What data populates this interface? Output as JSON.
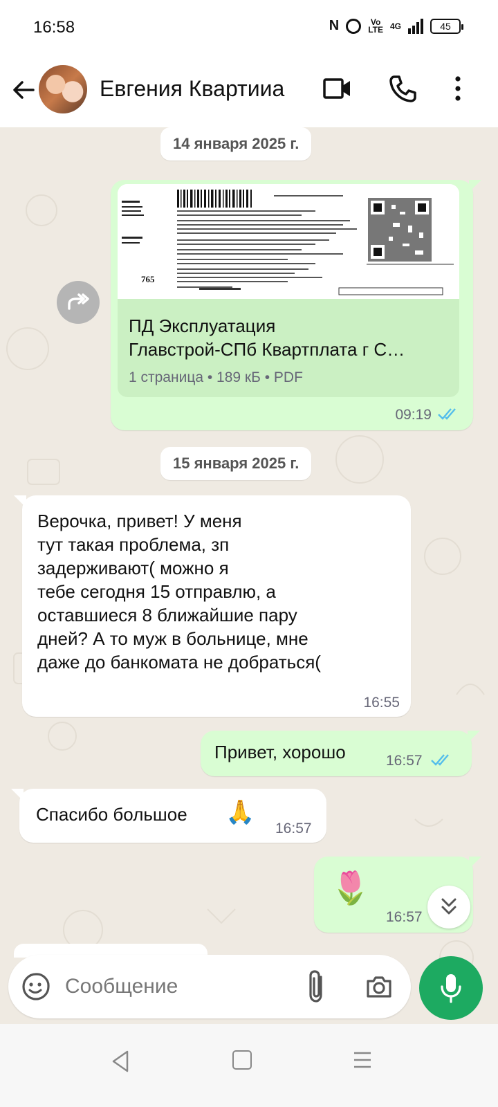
{
  "status_bar": {
    "time": "16:58",
    "icons": [
      "nfc-icon",
      "alarm-icon",
      "volte-icon",
      "signal-4g-icon",
      "battery-icon"
    ],
    "network": "4G",
    "battery": "45"
  },
  "header": {
    "contact_name": "Евгения Квартииа",
    "icons": [
      "back-arrow-icon",
      "video-call-icon",
      "phone-icon",
      "more-vert-icon"
    ]
  },
  "chat": {
    "date_1": "14 января 2025 г.",
    "document": {
      "title_line1": "ПД Эксплуатация",
      "title_line2": "Главстрой-СПб Квартплата г С…",
      "meta": "1 страница • 189 кБ • PDF",
      "preview_number": "765",
      "time": "09:19",
      "status": "read"
    },
    "date_2": "15 января 2025 г.",
    "messages": [
      {
        "direction": "in",
        "lines": [
          "Верочка, привет! У меня",
          "тут такая проблема, зп",
          "задерживают( можно я",
          "тебе сегодня 15 отправлю, а",
          "оставшиеся 8 ближайшие пару",
          "дней? А то муж в больнице, мне",
          "даже до банкомата не добраться("
        ],
        "time": "16:55"
      },
      {
        "direction": "out",
        "text": "Привет, хорошо",
        "time": "16:57",
        "status": "read"
      },
      {
        "direction": "in",
        "text": "Спасибо большое",
        "emoji": "🙏",
        "time": "16:57"
      },
      {
        "direction": "out",
        "emoji": "🌷",
        "time": "16:57"
      }
    ]
  },
  "composer": {
    "placeholder": "Сообщение",
    "icons": [
      "sticker-icon",
      "paperclip-icon",
      "camera-icon",
      "mic-icon"
    ]
  },
  "colors": {
    "outgoing_bubble": "#d9fdd3",
    "incoming_bubble": "#ffffff",
    "chat_background": "#efeae2",
    "read_ticks": "#53bdeb",
    "accent_green": "#1daa61"
  }
}
